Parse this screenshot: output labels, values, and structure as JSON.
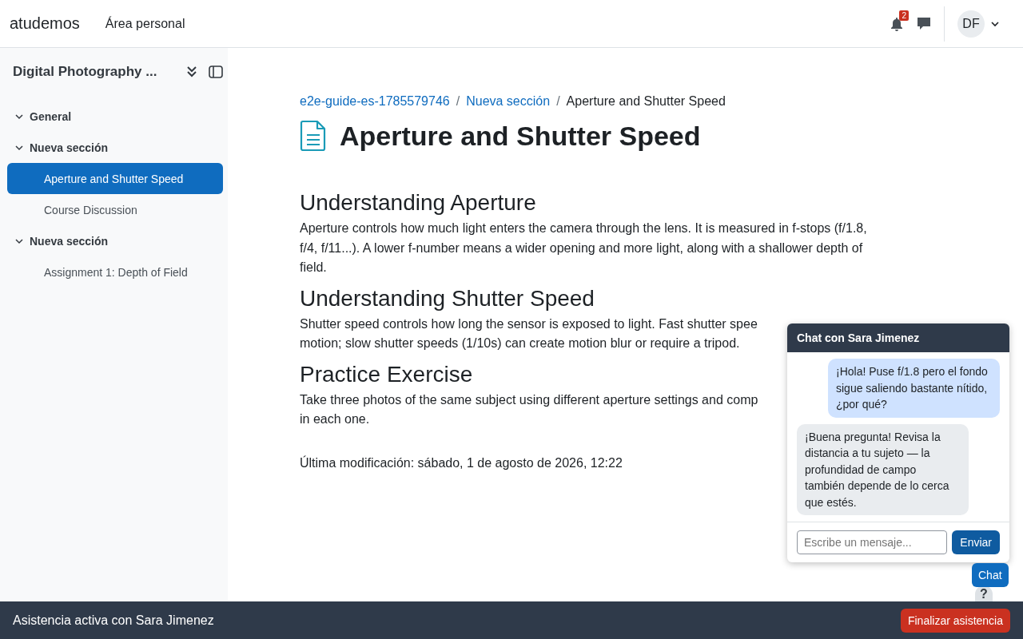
{
  "header": {
    "brand": "atudemos",
    "nav_link": "Área personal",
    "notifications_count": "2",
    "avatar_initials": "DF"
  },
  "sidebar": {
    "course_title": "Digital Photography ...",
    "items": [
      {
        "label": "General",
        "kind": "section",
        "expanded": true,
        "selected": false
      },
      {
        "label": "Nueva sección",
        "kind": "section",
        "expanded": true,
        "selected": false
      },
      {
        "label": "Aperture and Shutter Speed",
        "kind": "activity",
        "selected": true
      },
      {
        "label": "Course Discussion",
        "kind": "activity",
        "selected": false
      },
      {
        "label": "Nueva sección",
        "kind": "section",
        "expanded": true,
        "selected": false
      },
      {
        "label": "Assignment 1: Depth of Field",
        "kind": "activity",
        "selected": false
      }
    ]
  },
  "breadcrumb": [
    {
      "label": "e2e-guide-es-1785579746",
      "separator": "/"
    },
    {
      "label": "Nueva sección",
      "separator": "/"
    },
    {
      "label": "Aperture and Shutter Speed"
    }
  ],
  "page_title": "Aperture and Shutter Speed",
  "sections": [
    {
      "heading": "Understanding Aperture",
      "lines": [
        "Aperture controls how much light enters the camera through the lens. It is measured in f-stops (f/1.8,",
        "f/4, f/11...). A lower f-number means a wider opening and more light, along with a shallower depth of",
        "field."
      ]
    },
    {
      "heading": "Understanding Shutter Speed",
      "lines": [
        "Shutter speed controls how long the sensor is exposed to light. Fast shutter spee",
        "motion; slow shutter speeds (1/10s) can create motion blur or require a tripod."
      ]
    },
    {
      "heading": "Practice Exercise",
      "lines": [
        "Take three photos of the same subject using different aperture settings and comp",
        "in each one."
      ]
    }
  ],
  "last_modified": "Última modificación: sábado, 1 de agosto de 2026, 12:22",
  "chat": {
    "title": "Chat con Sara Jimenez",
    "messages": [
      {
        "kind": "sent",
        "text": "¡Hola! Puse f/1.8 pero el fondo sigue saliendo bastante nítido, ¿por qué?"
      },
      {
        "kind": "received",
        "text": "¡Buena pregunta! Revisa la distancia a tu sujeto — la profundidad de campo también depende de lo cerca que estés."
      }
    ],
    "input_placeholder": "Escribe un mensaje...",
    "send_button": "Enviar",
    "toggle_button": "Chat",
    "help_button": "?"
  },
  "footer": {
    "status": "Asistencia activa con Sara Jimenez",
    "end_button": "Finalizar asistencia"
  }
}
